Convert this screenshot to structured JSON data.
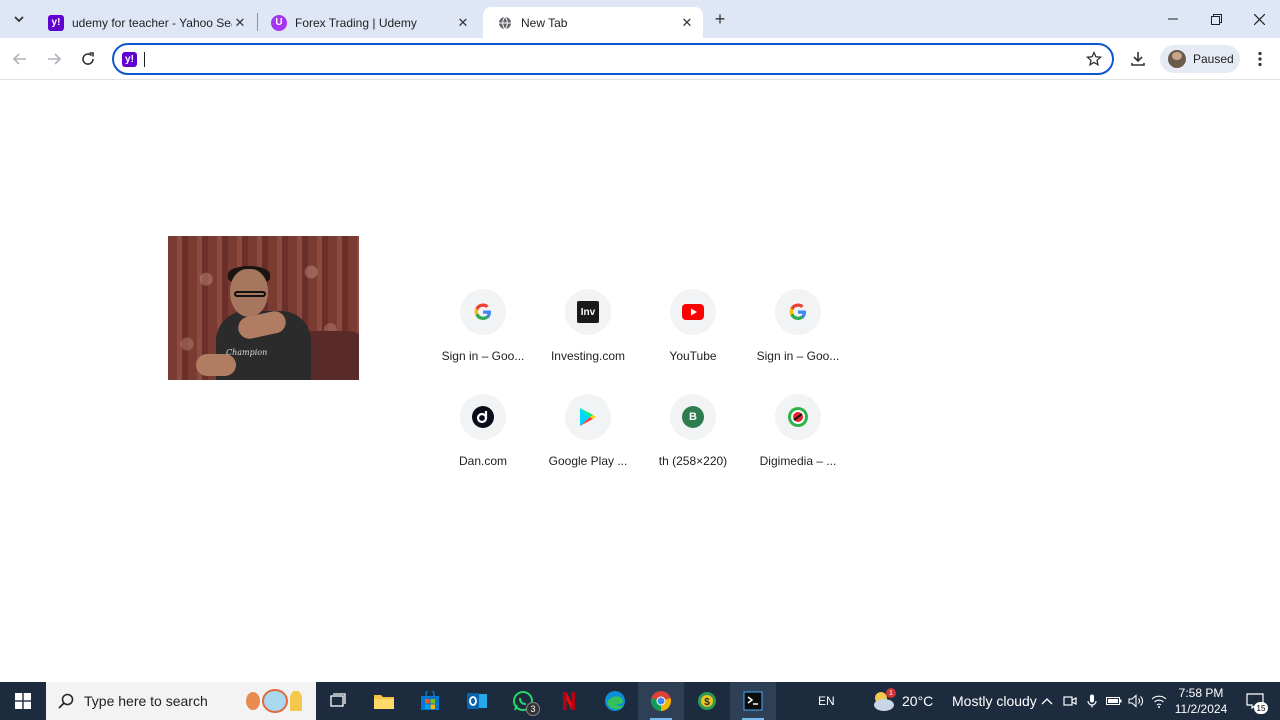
{
  "browser": {
    "tabs": [
      {
        "title": "udemy for teacher - Yahoo Sear",
        "favicon": "yahoo-icon",
        "color": "#6001d2"
      },
      {
        "title": "Forex Trading | Udemy",
        "favicon": "udemy-icon",
        "color": "#a435f0"
      },
      {
        "title": "New Tab",
        "favicon": "globe-icon",
        "color": "#5f6368"
      }
    ],
    "omnibox_value": "",
    "profile_status": "Paused"
  },
  "shortcuts": [
    {
      "name": "Sign in – Goo...",
      "icon": "google-icon"
    },
    {
      "name": "Investing.com",
      "icon": "investing-icon"
    },
    {
      "name": "YouTube",
      "icon": "youtube-icon"
    },
    {
      "name": "Sign in – Goo...",
      "icon": "google-icon"
    },
    {
      "name": "Dan.com",
      "icon": "dan-icon"
    },
    {
      "name": "Google Play ...",
      "icon": "google-play-icon"
    },
    {
      "name": "th (258×220)",
      "icon": "letter-b-icon",
      "letter": "B"
    },
    {
      "name": "Digimedia – ...",
      "icon": "digimedia-icon"
    }
  ],
  "taskbar": {
    "search_placeholder": "Type here to search",
    "whatsapp_badge": "3",
    "language": "EN",
    "weather_temp": "20°C",
    "weather_desc": "Mostly cloudy",
    "weather_alert": "1",
    "time": "7:58 PM",
    "date": "11/2/2024",
    "notification_count": "15"
  },
  "colors": {
    "tabstrip": "#dfe7f7",
    "omnibox_border": "#0b57d0",
    "taskbar": "#1d2b3f"
  }
}
